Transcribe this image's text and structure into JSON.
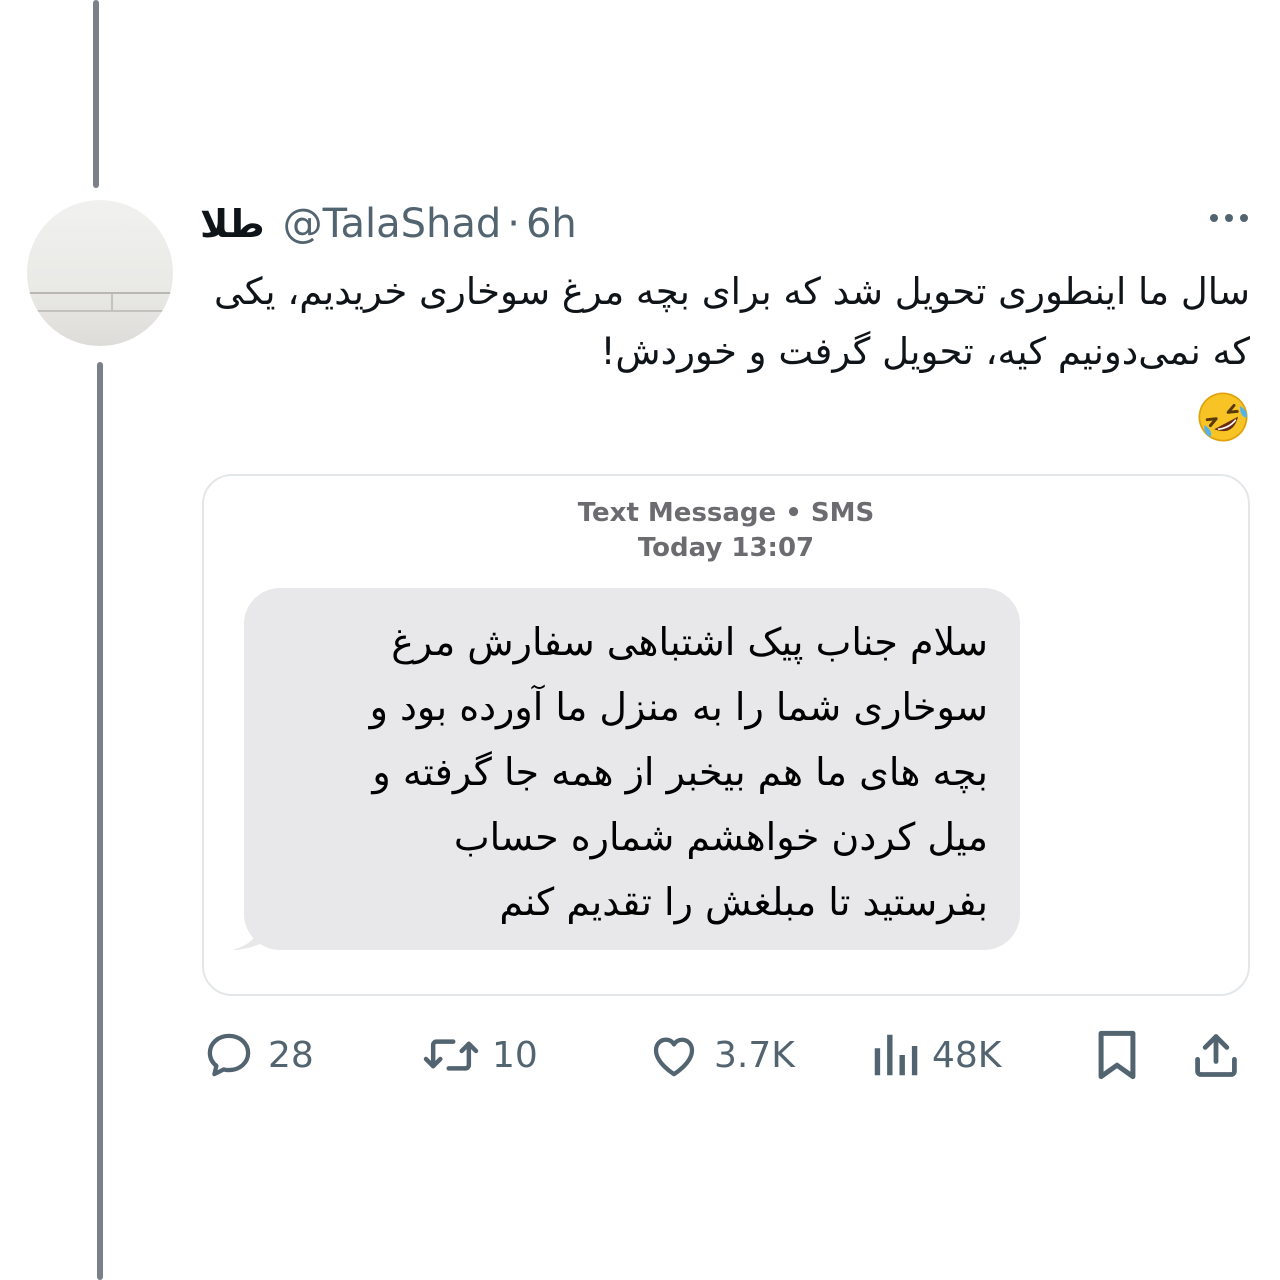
{
  "tweet": {
    "display_name": "طلا",
    "handle": "@TalaShad",
    "separator": "·",
    "time": "6h",
    "text": "سال ما اینطوری تحویل شد که برای بچه مرغ سوخاری خریدیم، یکی که نمی‌دونیم کیه، تحویل گرفت و خوردش!",
    "emoji": "rolling-on-floor-laughing"
  },
  "sms_card": {
    "header_line1": "Text Message • SMS",
    "header_line2": "Today 13:07",
    "message_lines": [
      "سلام جناب پیک اشتباهی سفارش مرغ",
      "سوخاری شما را به منزل ما آورده بود و",
      "بچه های ما هم بیخبر از همه جا گرفته و",
      "میل کردن خواهشم شماره حساب",
      "بفرستید تا مبلغش را تقدیم کنم"
    ]
  },
  "actions": {
    "replies": "28",
    "retweets": "10",
    "likes": "3.7K",
    "views": "48K"
  },
  "icons": {
    "more": "more-horizontal-icon",
    "reply": "comment-icon",
    "retweet": "retweet-icon",
    "like": "heart-icon",
    "views": "analytics-icon",
    "bookmark": "bookmark-icon",
    "share": "share-icon"
  },
  "colors": {
    "text_primary": "#0f1419",
    "text_secondary": "#536471",
    "bubble_bg": "#e8e8ea",
    "card_border": "#e4e7ea"
  }
}
